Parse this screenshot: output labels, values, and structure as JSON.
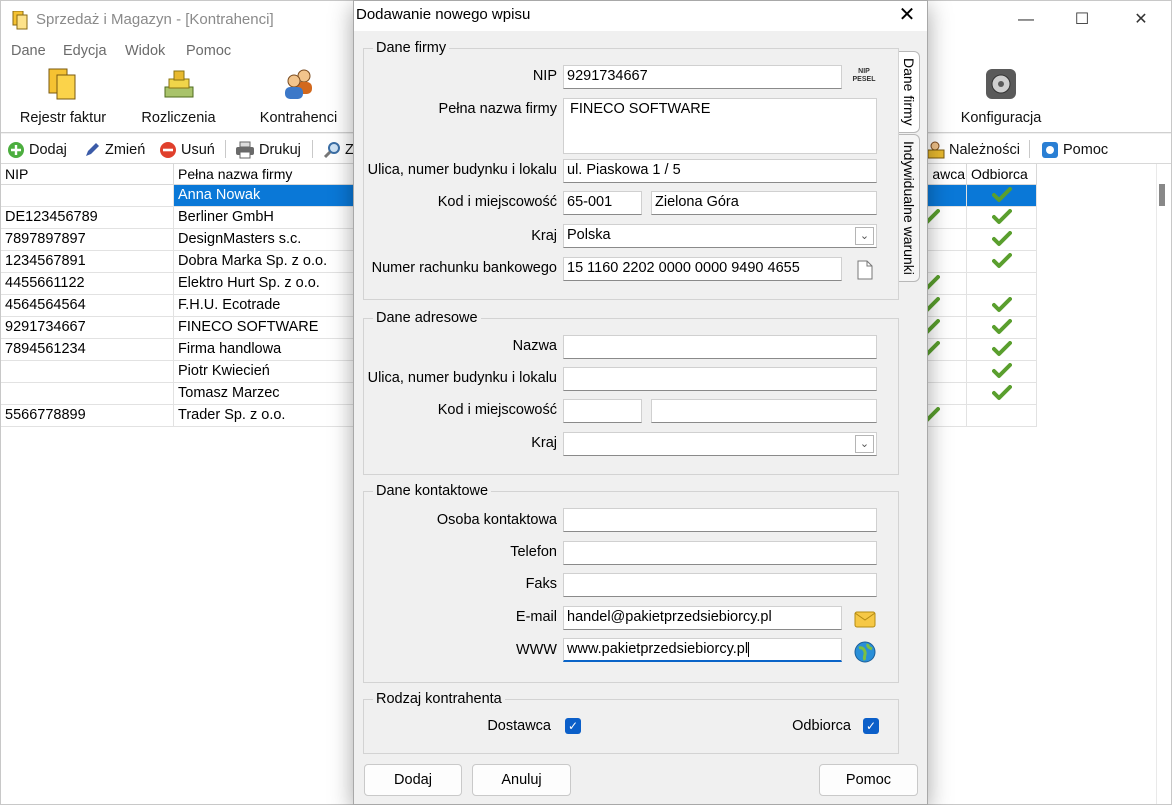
{
  "window": {
    "title": "Sprzedaż i Magazyn - [Kontrahenci]",
    "controls": [
      "—",
      "☐",
      "✕"
    ]
  },
  "menu": [
    "Dane",
    "Edycja",
    "Widok",
    "Pomoc"
  ],
  "ribbon": {
    "buttons": [
      "Rejestr faktur",
      "Rozliczenia",
      "Kontrahenci",
      "Konfiguracja"
    ]
  },
  "toolbar": {
    "add": "Dodaj",
    "change": "Zmień",
    "delete": "Usuń",
    "print": "Drukuj",
    "search_partial": "Z",
    "receivables": "Należności",
    "help": "Pomoc"
  },
  "grid": {
    "headers": [
      "NIP",
      "Pełna nazwa firmy",
      "awca",
      "Odbiorca"
    ],
    "rows": [
      {
        "nip": "",
        "name": "Anna Nowak",
        "supplier": false,
        "buyer": true
      },
      {
        "nip": "DE123456789",
        "name": "Berliner GmbH",
        "supplier": true,
        "buyer": true
      },
      {
        "nip": "7897897897",
        "name": "DesignMasters s.c.",
        "supplier": false,
        "buyer": true
      },
      {
        "nip": "1234567891",
        "name": "Dobra Marka Sp. z o.o.",
        "supplier": false,
        "buyer": true
      },
      {
        "nip": "4455661122",
        "name": "Elektro Hurt Sp. z o.o.",
        "supplier": true,
        "buyer": false
      },
      {
        "nip": "4564564564",
        "name": "F.H.U. Ecotrade",
        "supplier": true,
        "buyer": true
      },
      {
        "nip": "9291734667",
        "name": "FINECO SOFTWARE",
        "supplier": true,
        "buyer": true
      },
      {
        "nip": "7894561234",
        "name": "Firma handlowa",
        "supplier": true,
        "buyer": true
      },
      {
        "nip": "",
        "name": "Piotr Kwiecień",
        "supplier": false,
        "buyer": true
      },
      {
        "nip": "",
        "name": "Tomasz Marzec",
        "supplier": false,
        "buyer": true
      },
      {
        "nip": "5566778899",
        "name": "Trader Sp. z o.o.",
        "supplier": true,
        "buyer": false
      }
    ]
  },
  "dialog": {
    "title": "Dodawanie nowego wpisu",
    "tabs": [
      "Dane firmy",
      "Indywidualne warunki"
    ],
    "company": {
      "group": "Dane firmy",
      "nip_label": "NIP",
      "nip": "9291734667",
      "nip_badge_top": "NIP",
      "nip_badge_bottom": "PESEL",
      "name_label": "Pełna nazwa firmy",
      "name": "FINECO  SOFTWARE",
      "street_label": "Ulica, numer budynku i lokalu",
      "street": "ul. Piaskowa 1 / 5",
      "city_label": "Kod i miejscowość",
      "postcode": "65-001",
      "city": "Zielona Góra",
      "country_label": "Kraj",
      "country": "Polska",
      "account_label": "Numer rachunku bankowego",
      "account": "15 1160 2202 0000 0000 9490 4655"
    },
    "address": {
      "group": "Dane adresowe",
      "name_label": "Nazwa",
      "street_label": "Ulica, numer budynku i lokalu",
      "city_label": "Kod i miejscowość",
      "country_label": "Kraj"
    },
    "contact": {
      "group": "Dane kontaktowe",
      "person_label": "Osoba kontaktowa",
      "phone_label": "Telefon",
      "fax_label": "Faks",
      "email_label": "E-mail",
      "email": "handel@pakietprzedsiebiorcy.pl",
      "www_label": "WWW",
      "www": "www.pakietprzedsiebiorcy.pl"
    },
    "type": {
      "group": "Rodzaj kontrahenta",
      "supplier_label": "Dostawca",
      "supplier_checked": true,
      "buyer_label": "Odbiorca",
      "buyer_checked": true
    },
    "buttons": {
      "add": "Dodaj",
      "cancel": "Anuluj",
      "help": "Pomoc"
    }
  },
  "colors": {
    "selection": "#0a78d7",
    "check": "#5a9f2e",
    "accent": "#0b5fc9"
  }
}
